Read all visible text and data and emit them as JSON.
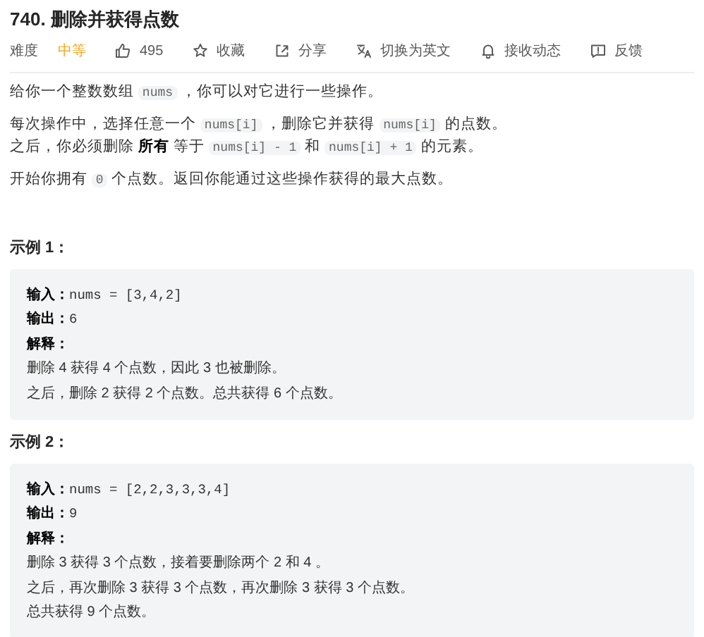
{
  "title": "740. 删除并获得点数",
  "difficulty": {
    "label": "难度",
    "value": "中等"
  },
  "actions": [
    {
      "kind": "like",
      "label": "495"
    },
    {
      "kind": "favorite",
      "label": "收藏"
    },
    {
      "kind": "share",
      "label": "分享"
    },
    {
      "kind": "translate",
      "label": "切换为英文"
    },
    {
      "kind": "subscribe",
      "label": "接收动态"
    },
    {
      "kind": "feedback",
      "label": "反馈"
    }
  ],
  "paragraphs": [
    [
      {
        "kind": "text",
        "text": "给你一个整数数组 "
      },
      {
        "kind": "code",
        "text": "nums"
      },
      {
        "kind": "text",
        "text": " ，你可以对它进行一些操作。"
      }
    ],
    [
      {
        "kind": "text",
        "text": "每次操作中，选择任意一个 "
      },
      {
        "kind": "code",
        "text": "nums[i]"
      },
      {
        "kind": "text",
        "text": " ，删除它并获得 "
      },
      {
        "kind": "code",
        "text": "nums[i]"
      },
      {
        "kind": "text",
        "text": " 的点数。之后，你必须删除 "
      },
      {
        "kind": "bold",
        "text": "所有"
      },
      {
        "kind": "text",
        "text": " 等于 "
      },
      {
        "kind": "code",
        "text": "nums[i] - 1"
      },
      {
        "kind": "text",
        "text": " 和 "
      },
      {
        "kind": "code",
        "text": "nums[i] + 1"
      },
      {
        "kind": "text",
        "text": " 的元素。"
      }
    ],
    [
      {
        "kind": "text",
        "text": "开始你拥有 "
      },
      {
        "kind": "code",
        "text": "0"
      },
      {
        "kind": "text",
        "text": " 个点数。返回你能通过这些操作获得的最大点数。"
      }
    ]
  ],
  "examples": [
    {
      "heading": "示例 1：",
      "input_label": "输入：",
      "input": "nums = [3,4,2]",
      "output_label": "输出：",
      "output": "6",
      "explanation_label": "解释：",
      "explanation": [
        "删除 4 获得 4 个点数，因此 3 也被删除。",
        "之后，删除 2 获得 2 个点数。总共获得 6 个点数。"
      ]
    },
    {
      "heading": "示例 2：",
      "input_label": "输入：",
      "input": "nums = [2,2,3,3,3,4]",
      "output_label": "输出：",
      "output": "9",
      "explanation_label": "解释：",
      "explanation": [
        "删除 3 获得 3 个点数，接着要删除两个 2 和 4 。",
        "之后，再次删除 3 获得 3 个点数，再次删除 3 获得 3 个点数。",
        "总共获得 9 个点数。"
      ]
    }
  ]
}
